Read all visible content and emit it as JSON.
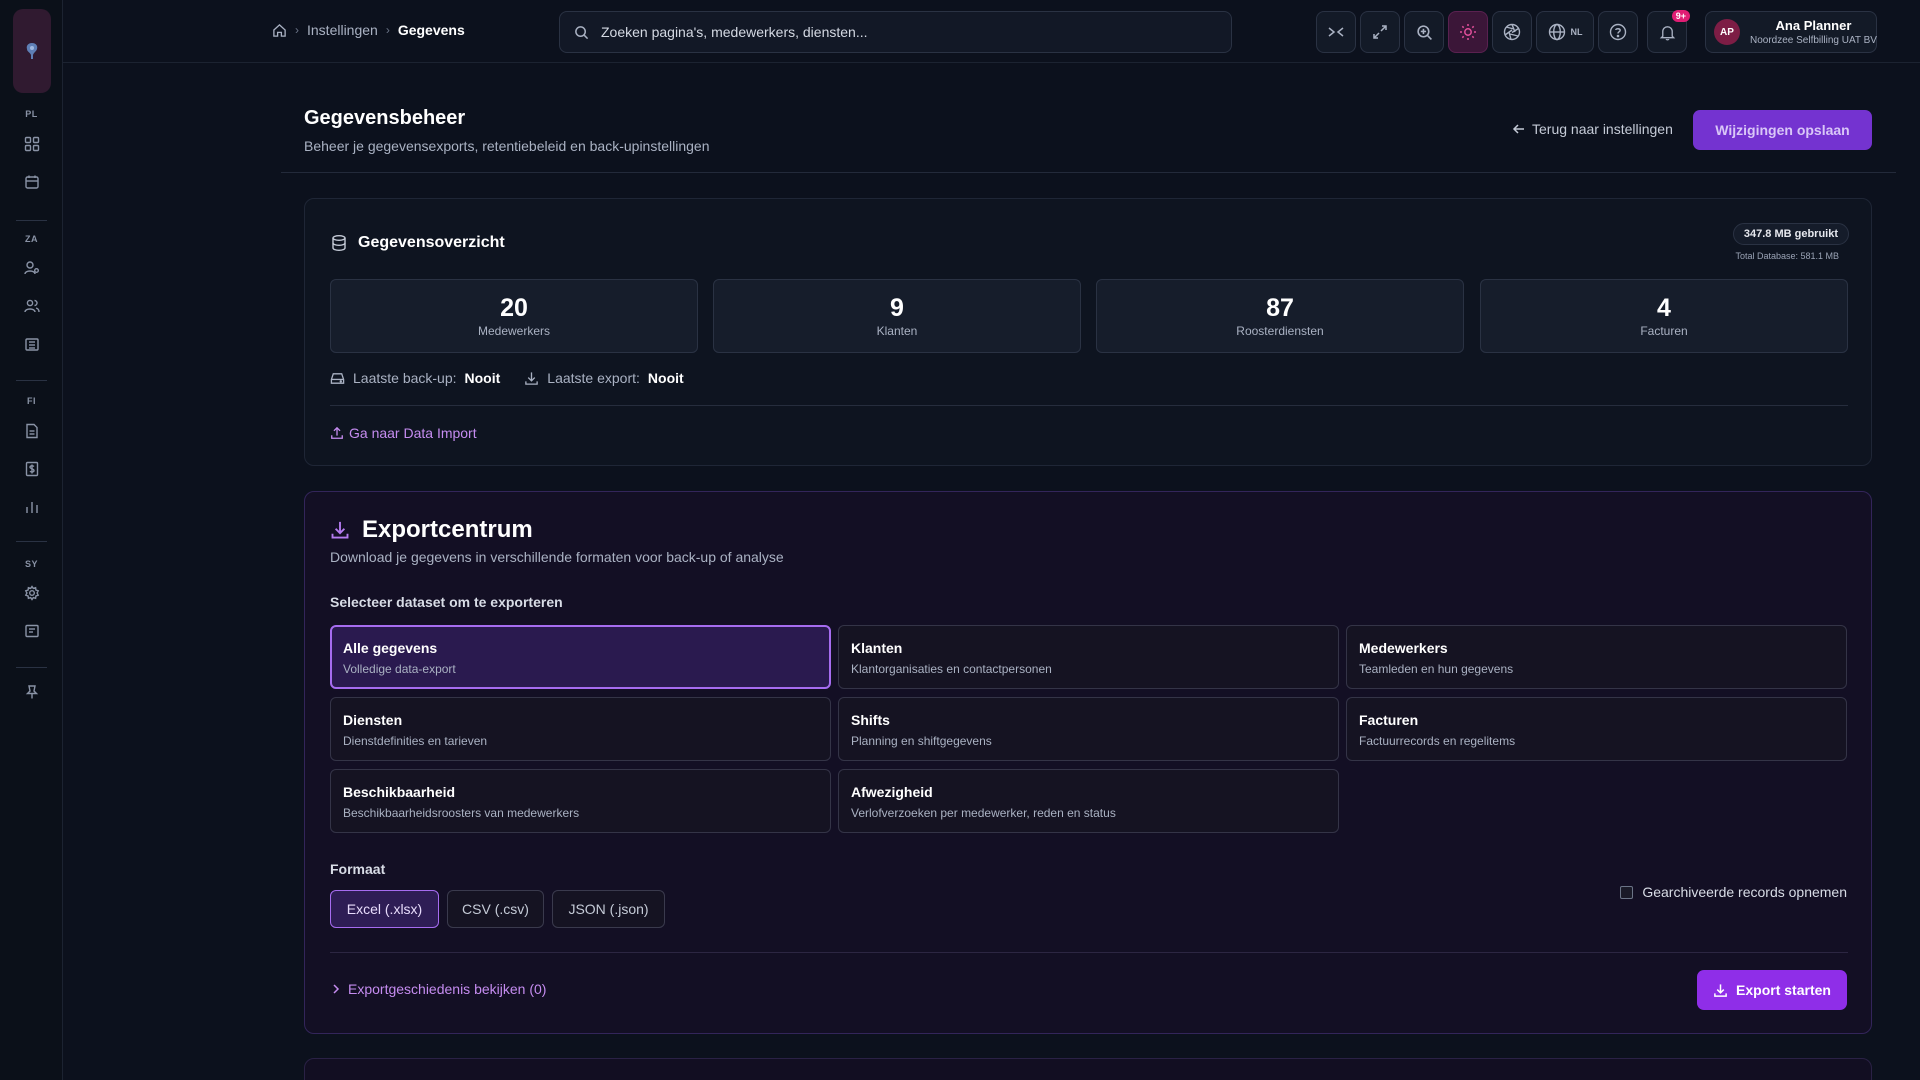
{
  "sidebar": {
    "logo_icon": "brand-logo-icon",
    "sections": [
      {
        "label": "PL",
        "items": [
          "dashboard-icon",
          "calendar-icon"
        ]
      },
      {
        "label": "ZA",
        "items": [
          "user-settings-icon",
          "users-icon",
          "building-icon"
        ]
      },
      {
        "label": "FI",
        "items": [
          "document-icon",
          "invoice-icon",
          "bar-chart-icon"
        ]
      },
      {
        "label": "SY",
        "items": [
          "gear-icon",
          "log-icon"
        ]
      }
    ],
    "footer_icon": "pin-icon"
  },
  "topbar": {
    "breadcrumb": {
      "home_icon": "home-icon",
      "items": [
        "Instellingen",
        "Gegevens"
      ]
    },
    "search": {
      "placeholder": "Zoeken pagina's, medewerkers, diensten..."
    },
    "buttons": [
      "collapse-icon",
      "fullscreen-icon",
      "zoom-icon",
      "theme-sun-icon",
      "aperture-icon",
      "language-icon",
      "help-icon",
      "bell-icon"
    ],
    "language": "NL",
    "notifications_badge": "9+",
    "user": {
      "initials": "AP",
      "name": "Ana Planner",
      "org": "Noordzee Selfbilling UAT BV"
    }
  },
  "header": {
    "title": "Gegevensbeheer",
    "subtitle": "Beheer je gegevensexports, retentiebeleid en back-upinstellingen",
    "back_label": "Terug naar instellingen",
    "save_label": "Wijzigingen opslaan"
  },
  "overview": {
    "title": "Gegevensoverzicht",
    "usage": "347.8 MB gebruikt",
    "usage_total": "Total Database: 581.1 MB",
    "stats": [
      {
        "value": "20",
        "label": "Medewerkers"
      },
      {
        "value": "9",
        "label": "Klanten"
      },
      {
        "value": "87",
        "label": "Roosterdiensten"
      },
      {
        "value": "4",
        "label": "Facturen"
      }
    ],
    "last_backup_label": "Laatste back-up:",
    "last_backup_value": "Nooit",
    "last_export_label": "Laatste export:",
    "last_export_value": "Nooit",
    "import_link": "Ga naar Data Import"
  },
  "export": {
    "title": "Exportcentrum",
    "subtitle": "Download je gegevens in verschillende formaten voor back-up of analyse",
    "dataset_label": "Selecteer dataset om te exporteren",
    "datasets": [
      {
        "name": "Alle gegevens",
        "desc": "Volledige data-export"
      },
      {
        "name": "Klanten",
        "desc": "Klantorganisaties en contactpersonen"
      },
      {
        "name": "Medewerkers",
        "desc": "Teamleden en hun gegevens"
      },
      {
        "name": "Diensten",
        "desc": "Dienstdefinities en tarieven"
      },
      {
        "name": "Shifts",
        "desc": "Planning en shiftgegevens"
      },
      {
        "name": "Facturen",
        "desc": "Factuurrecords en regelitems"
      },
      {
        "name": "Beschikbaarheid",
        "desc": "Beschikbaarheidsroosters van medewerkers"
      },
      {
        "name": "Afwezigheid",
        "desc": "Verlofverzoeken per medewerker, reden en status"
      }
    ],
    "selected_dataset": "Alle gegevens",
    "format_label": "Formaat",
    "formats": [
      "Excel (.xlsx)",
      "CSV (.csv)",
      "JSON (.json)"
    ],
    "selected_format": "Excel (.xlsx)",
    "archived_label": "Gearchiveerde records opnemen",
    "archived_checked": false,
    "history_link": "Exportgeschiedenis bekijken (0)",
    "start_label": "Export starten"
  },
  "colors": {
    "accent": "#8f2ee8",
    "link": "#c58cf0",
    "selected_border": "#a66cf0"
  }
}
